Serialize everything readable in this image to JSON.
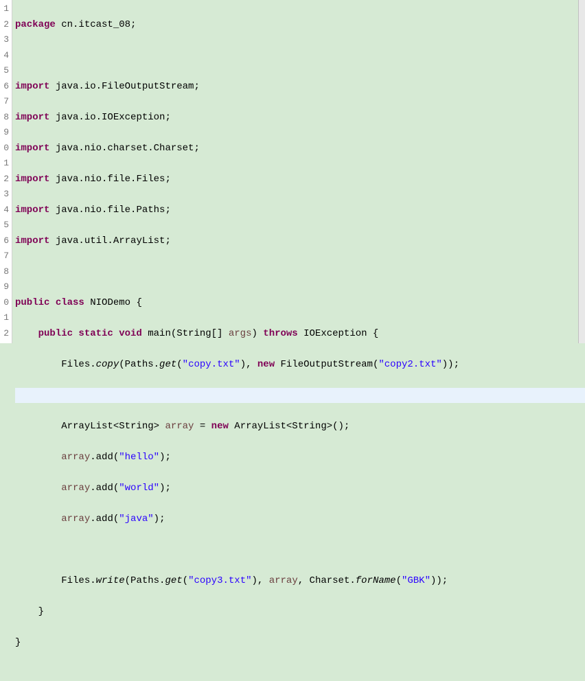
{
  "gutter": [
    "1",
    "2",
    "3",
    "4",
    "5",
    "6",
    "7",
    "8",
    "9",
    "0",
    "1",
    "2",
    "3",
    "4",
    "5",
    "6",
    "7",
    "8",
    "9",
    "0",
    "1",
    "2"
  ],
  "code": {
    "l1_kw": "package",
    "l1_pkg": " cn.itcast_08;",
    "l3_kw": "import",
    "l3_txt": " java.io.FileOutputStream;",
    "l4_kw": "import",
    "l4_txt": " java.io.IOException;",
    "l5_kw": "import",
    "l5_txt": " java.nio.charset.Charset;",
    "l6_kw": "import",
    "l6_txt": " java.nio.file.Files;",
    "l7_kw": "import",
    "l7_txt": " java.nio.file.Paths;",
    "l8_kw": "import",
    "l8_txt": " java.util.ArrayList;",
    "l10_kw1": "public",
    "l10_kw2": " class",
    "l10_cls": " NIODemo {",
    "l11_kw1": "    public",
    "l11_kw2": " static",
    "l11_kw3": " void",
    "l11_m": " main(String[] ",
    "l11_arg": "args",
    "l11_paren": ") ",
    "l11_kw4": "throws",
    "l11_exc": " IOException {",
    "l12_a": "        Files.",
    "l12_copy": "copy",
    "l12_b": "(Paths.",
    "l12_get": "get",
    "l12_c": "(",
    "l12_s1": "\"copy.txt\"",
    "l12_d": "), ",
    "l12_kw": "new",
    "l12_e": " FileOutputStream(",
    "l12_s2": "\"copy2.txt\"",
    "l12_f": "));",
    "l14_a": "        ArrayList<String> ",
    "l14_var": "array",
    "l14_b": " = ",
    "l14_kw": "new",
    "l14_c": " ArrayList<String>();",
    "l15_a": "        ",
    "l15_var": "array",
    "l15_b": ".add(",
    "l15_s": "\"hello\"",
    "l15_c": ");",
    "l16_a": "        ",
    "l16_var": "array",
    "l16_b": ".add(",
    "l16_s": "\"world\"",
    "l16_c": ");",
    "l17_a": "        ",
    "l17_var": "array",
    "l17_b": ".add(",
    "l17_s": "\"java\"",
    "l17_c": ");",
    "l19_a": "        Files.",
    "l19_write": "write",
    "l19_b": "(Paths.",
    "l19_get": "get",
    "l19_c": "(",
    "l19_s1": "\"copy3.txt\"",
    "l19_d": "), ",
    "l19_var": "array",
    "l19_e": ", Charset.",
    "l19_for": "forName",
    "l19_f": "(",
    "l19_s2": "\"GBK\"",
    "l19_g": "));",
    "l20": "    }",
    "l21": "}"
  }
}
